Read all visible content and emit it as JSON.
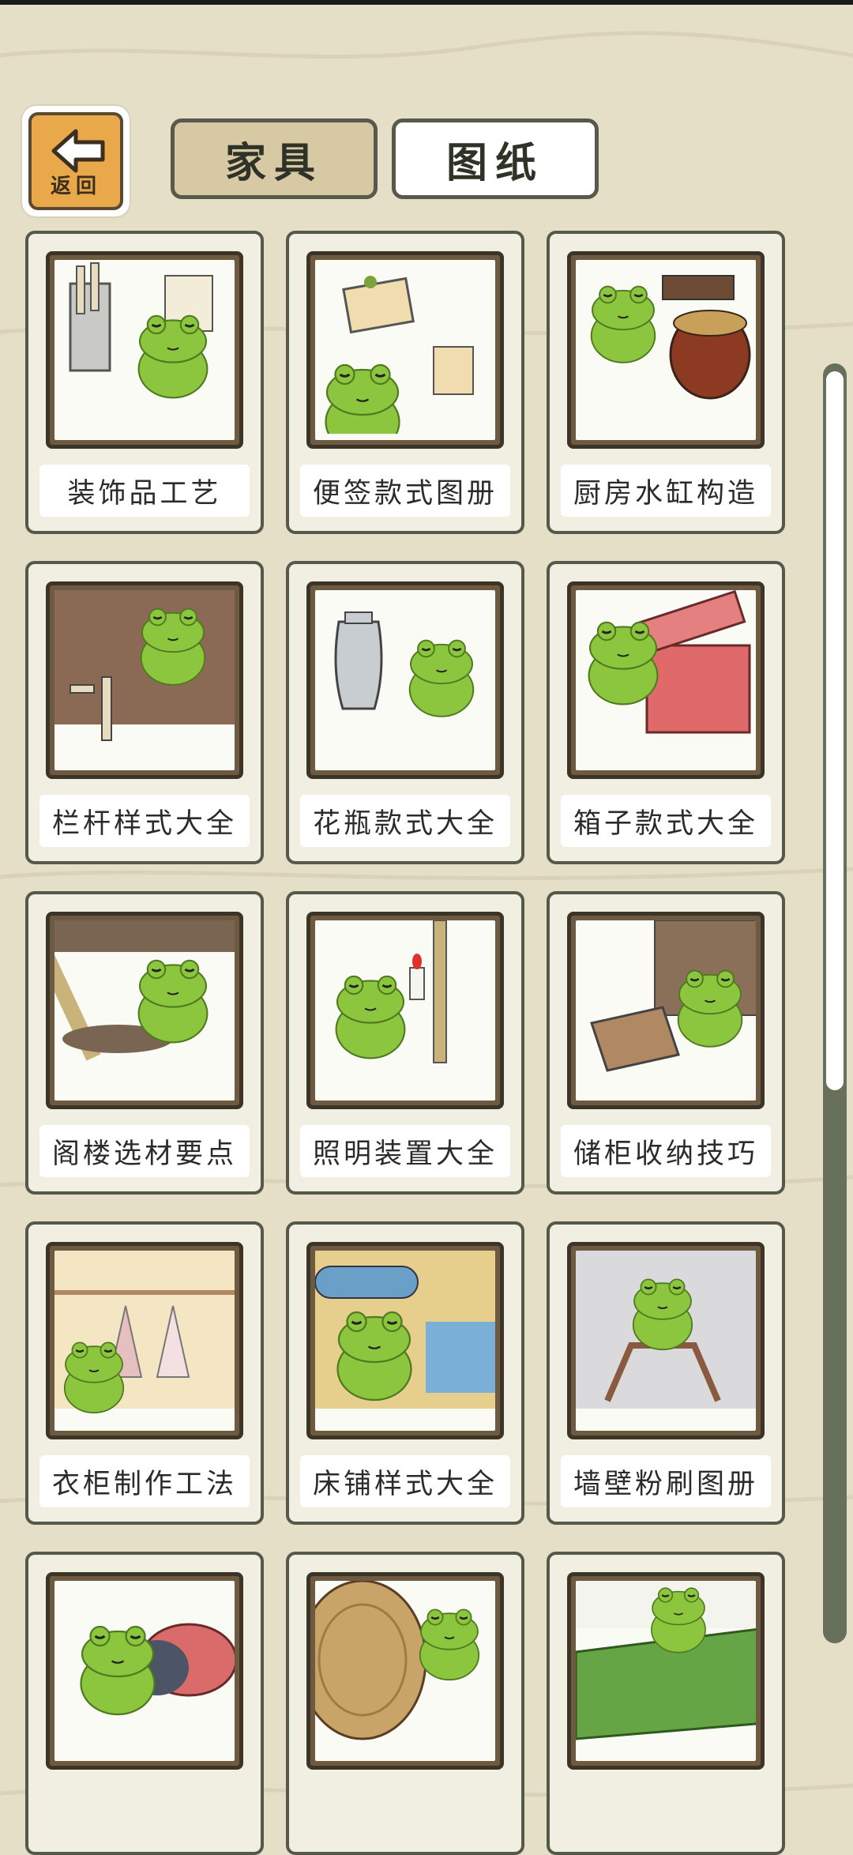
{
  "back_button": {
    "label": "返回",
    "icon": "left-arrow-icon"
  },
  "tabs": [
    {
      "label": "家具",
      "active": true
    },
    {
      "label": "图纸",
      "active": false
    }
  ],
  "items": [
    {
      "label": "装饰品工艺",
      "scene": "craft"
    },
    {
      "label": "便签款式图册",
      "scene": "memo"
    },
    {
      "label": "厨房水缸构造",
      "scene": "jar"
    },
    {
      "label": "栏杆样式大全",
      "scene": "rail"
    },
    {
      "label": "花瓶款式大全",
      "scene": "vase"
    },
    {
      "label": "箱子款式大全",
      "scene": "box"
    },
    {
      "label": "阁楼选材要点",
      "scene": "attic"
    },
    {
      "label": "照明装置大全",
      "scene": "light"
    },
    {
      "label": "储柜收纳技巧",
      "scene": "cabinet"
    },
    {
      "label": "衣柜制作工法",
      "scene": "wardrobe"
    },
    {
      "label": "床铺样式大全",
      "scene": "bed"
    },
    {
      "label": "墙壁粉刷图册",
      "scene": "wall"
    },
    {
      "label": "",
      "scene": "cushion"
    },
    {
      "label": "",
      "scene": "table"
    },
    {
      "label": "",
      "scene": "rug"
    }
  ],
  "colors": {
    "background": "#e5dfc8",
    "card_border": "#55594a",
    "frog_green": "#8cc63e",
    "back_button": "#e9a94a"
  }
}
